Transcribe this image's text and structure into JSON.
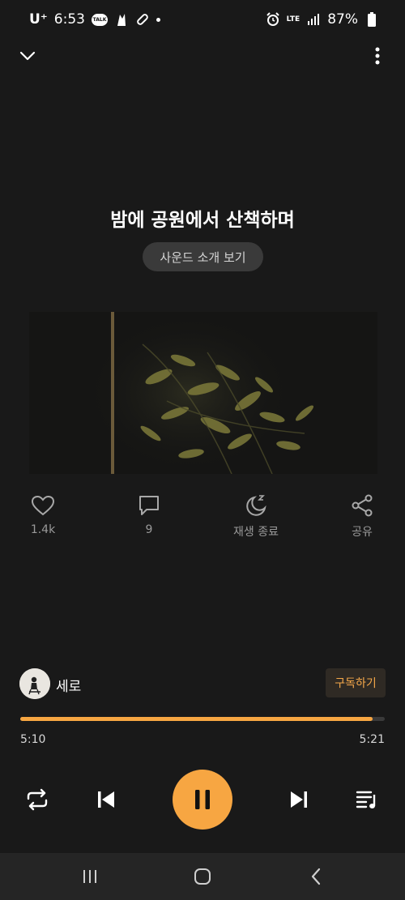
{
  "status_bar": {
    "carrier": "U⁺",
    "time": "6:53",
    "talk_icon_text": "TALK",
    "network": "LTE",
    "battery": "87%"
  },
  "track": {
    "title": "밤에 공원에서 산책하며",
    "intro_button": "사운드 소개 보기"
  },
  "actions": {
    "like_count": "1.4k",
    "comment_count": "9",
    "sleep_label": "재생 종료",
    "share_label": "공유"
  },
  "artist": {
    "name": "세로",
    "subscribe_label": "구독하기"
  },
  "progress": {
    "elapsed": "5:10",
    "total": "5:21",
    "fraction": 0.966
  },
  "colors": {
    "accent": "#f7a642",
    "background": "#191919"
  }
}
